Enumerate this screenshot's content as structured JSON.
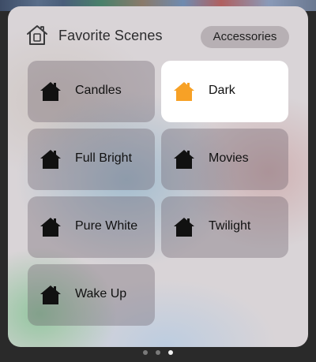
{
  "header": {
    "title": "Favorite Scenes",
    "accessories_label": "Accessories"
  },
  "scenes": [
    {
      "label": "Candles",
      "icon": "house-icon",
      "active": false
    },
    {
      "label": "Dark",
      "icon": "house-icon",
      "active": true
    },
    {
      "label": "Full Bright",
      "icon": "house-icon",
      "active": false
    },
    {
      "label": "Movies",
      "icon": "house-icon",
      "active": false
    },
    {
      "label": "Pure White",
      "icon": "house-icon",
      "active": false
    },
    {
      "label": "Twilight",
      "icon": "house-icon",
      "active": false
    },
    {
      "label": "Wake Up",
      "icon": "house-icon",
      "active": false
    }
  ],
  "colors": {
    "active_icon": "#f7a126",
    "inactive_icon": "#111111",
    "active_tile": "#ffffff"
  },
  "pager": {
    "page_count": 3,
    "current_page": 3
  }
}
